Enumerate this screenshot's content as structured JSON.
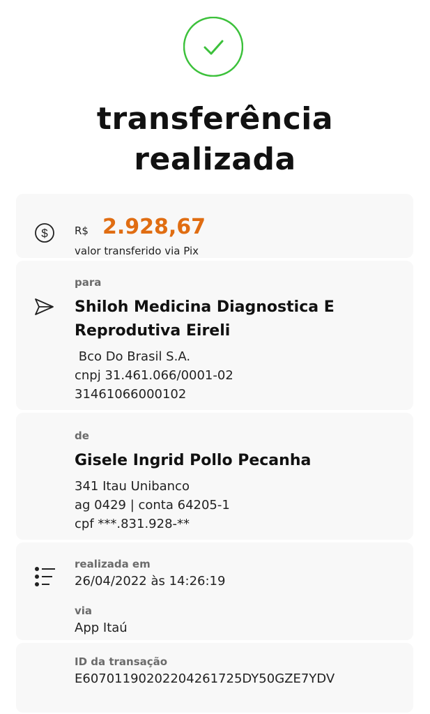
{
  "status": {
    "icon": "check-circle-icon",
    "title_line1": "transferência",
    "title_line2": "realizada",
    "color": "#3cc13b"
  },
  "amount": {
    "icon": "dollar-circle-icon",
    "currency": "R$",
    "value": "2.928,67",
    "caption": "valor transferido via Pix",
    "color": "#e06d12"
  },
  "recipient": {
    "icon": "send-icon",
    "label": "para",
    "name_line1": "Shiloh Medicina Diagnostica E",
    "name_line2": "Reprodutiva Eireli",
    "bank": " Bco Do Brasil S.A.",
    "doc": "cnpj 31.461.066/0001-02",
    "key": "31461066000102"
  },
  "sender": {
    "label": "de",
    "name": "Gisele Ingrid Pollo Pecanha",
    "bank": "341 Itau Unibanco",
    "account": "ag 0429 | conta 64205-1",
    "doc": "cpf ***.831.928-**"
  },
  "details": {
    "icon": "list-icon",
    "date_label": "realizada em",
    "date_value": "26/04/2022 às 14:26:19",
    "via_label": "via",
    "via_value": "App Itaú",
    "id_label": "ID da transação",
    "id_value": "E60701190202204261725DY50GZE7YDV"
  }
}
